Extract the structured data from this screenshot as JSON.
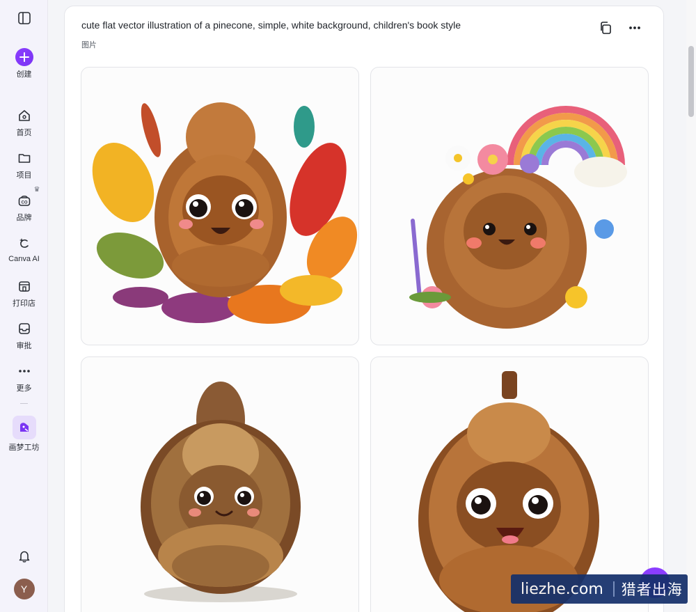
{
  "sidebar": {
    "toggle_icon": "sidebar-toggle-icon",
    "create_label": "创建",
    "items": [
      {
        "label": "首页",
        "icon": "home-icon"
      },
      {
        "label": "项目",
        "icon": "folder-icon"
      },
      {
        "label": "品牌",
        "icon": "brand-icon"
      },
      {
        "label": "Canva AI",
        "icon": "sparkle-icon"
      },
      {
        "label": "打印店",
        "icon": "print-shop-icon"
      },
      {
        "label": "审批",
        "icon": "inbox-icon"
      },
      {
        "label": "更多",
        "icon": "more-dots-icon"
      }
    ],
    "dream_lab_label": "画梦工坊",
    "avatar_letter": "Y",
    "accent_color": "#8b3dff"
  },
  "result": {
    "prompt": "cute flat vector illustration of a pinecone, simple, white background, children's book style",
    "type_label": "图片",
    "copy_icon": "copy-icon",
    "more_icon": "more-horizontal-icon",
    "images": [
      {
        "subject": "pinecone-with-autumn-leaves"
      },
      {
        "subject": "pinecone-with-flowers-and-rainbow"
      },
      {
        "subject": "realistic-pinecone-with-face"
      },
      {
        "subject": "pinecone-with-big-eyes"
      }
    ]
  },
  "watermark": {
    "site": "liezhe.com",
    "brand": "猎者出海"
  }
}
